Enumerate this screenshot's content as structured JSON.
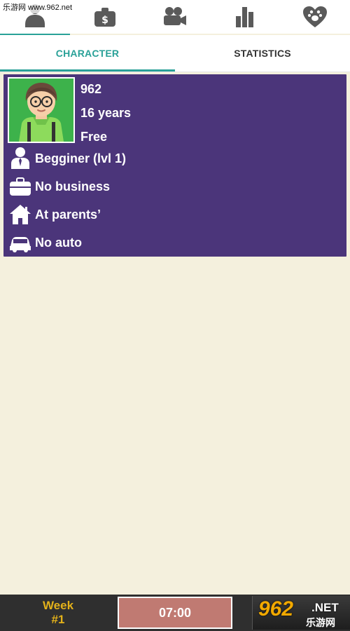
{
  "watermark": {
    "text": "乐游网 www.962.net"
  },
  "top_nav": {
    "items": [
      {
        "name": "person-icon",
        "active": true
      },
      {
        "name": "money-bag-icon",
        "active": false
      },
      {
        "name": "video-camera-icon",
        "active": false
      },
      {
        "name": "bar-chart-icon",
        "active": false
      },
      {
        "name": "heart-paw-icon",
        "active": false
      }
    ],
    "accent_color": "#2AA198"
  },
  "subtabs": {
    "character_label": "CHARACTER",
    "statistics_label": "STATISTICS",
    "active": "character"
  },
  "character": {
    "name": "962",
    "age": "16 years",
    "relationship": "Free",
    "card_color": "#4B357A",
    "avatar_bg": "#3DB24B",
    "rows": [
      {
        "icon": "person-tie-icon",
        "text": "Begginer (lvl 1)"
      },
      {
        "icon": "briefcase-icon",
        "text": "No business"
      },
      {
        "icon": "house-icon",
        "text": "At parents’"
      },
      {
        "icon": "car-icon",
        "text": "No auto"
      }
    ]
  },
  "bottom_bar": {
    "week_label": "Week",
    "week_number": "#1",
    "time": "07:00",
    "logo": {
      "main": "962",
      "suffix": ".NET",
      "sub": "乐游网"
    }
  }
}
